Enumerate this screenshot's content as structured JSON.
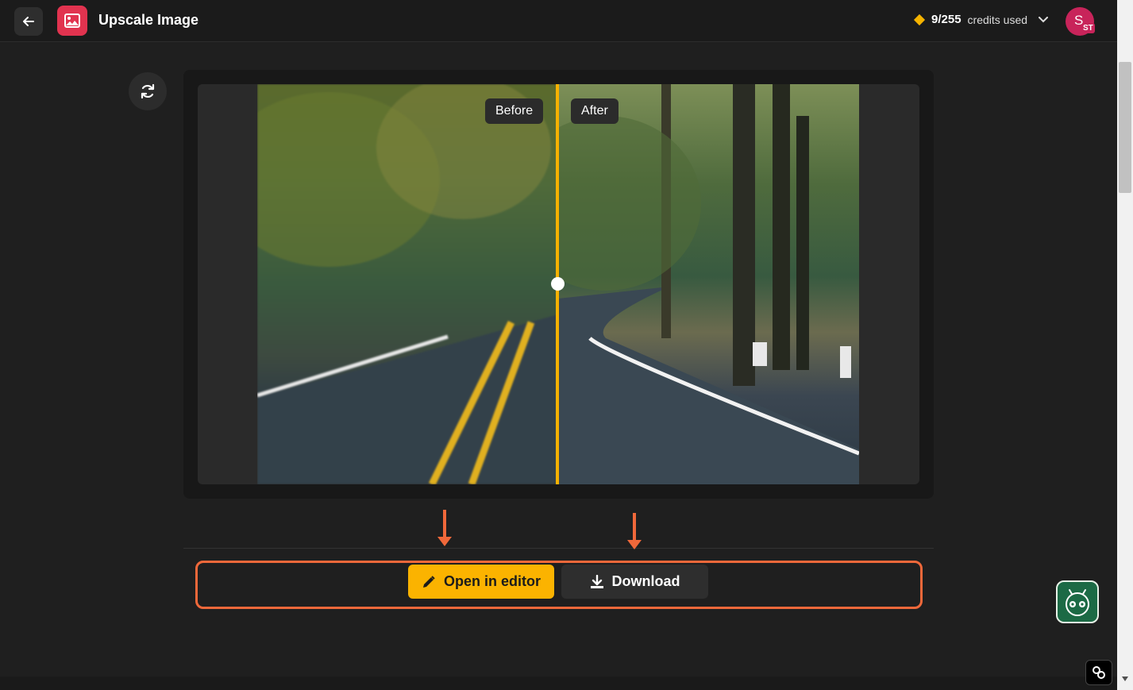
{
  "header": {
    "title": "Upscale Image",
    "credits_used": "9/255",
    "credits_label": "credits used",
    "avatar_letter": "S",
    "avatar_initials": "ST"
  },
  "comparison": {
    "before_label": "Before",
    "after_label": "After"
  },
  "actions": {
    "open_editor_label": "Open in editor",
    "download_label": "Download"
  },
  "colors": {
    "accent": "#fbb300",
    "annotation": "#f0683a",
    "app_icon": "#e1334f"
  },
  "icons": [
    "arrow-left-icon",
    "image-icon",
    "chevron-down-icon",
    "refresh-icon",
    "pencil-icon",
    "download-icon",
    "robot-icon",
    "link-icon"
  ]
}
